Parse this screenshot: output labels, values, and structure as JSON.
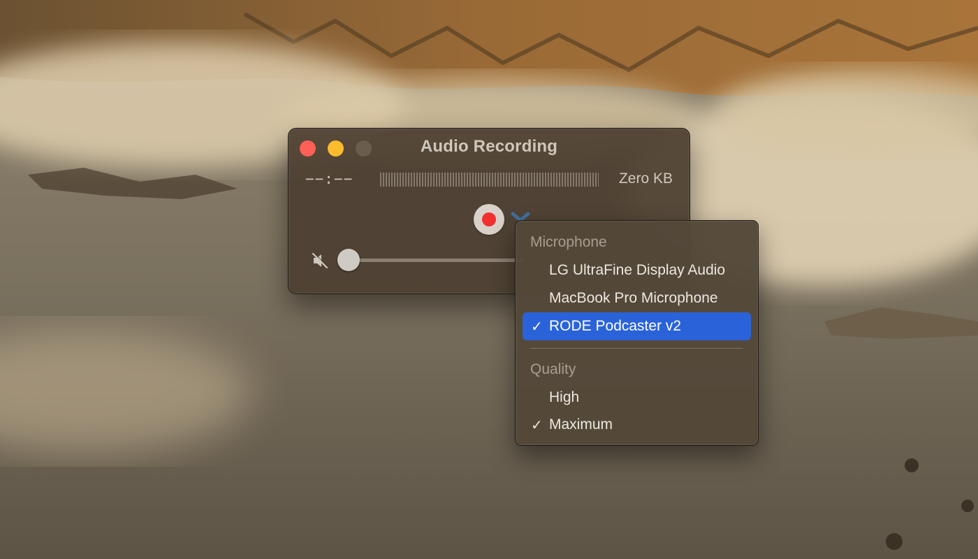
{
  "window": {
    "title": "Audio Recording",
    "time": "−−:−−",
    "file_size": "Zero KB",
    "volume_level": 0.0,
    "colors": {
      "close": "#fe5f57",
      "minimize": "#fdbb2e",
      "record": "#f22f2f"
    }
  },
  "menu": {
    "microphone_header": "Microphone",
    "microphones": [
      {
        "label": "LG UltraFine Display Audio",
        "checked": false,
        "check": ""
      },
      {
        "label": "MacBook Pro Microphone",
        "checked": false,
        "check": ""
      },
      {
        "label": "RODE Podcaster v2",
        "checked": true,
        "check": "✓"
      }
    ],
    "quality_header": "Quality",
    "qualities": [
      {
        "label": "High",
        "checked": false,
        "check": ""
      },
      {
        "label": "Maximum",
        "checked": true,
        "check": "✓"
      }
    ],
    "highlight_color": "#2a63d9"
  }
}
